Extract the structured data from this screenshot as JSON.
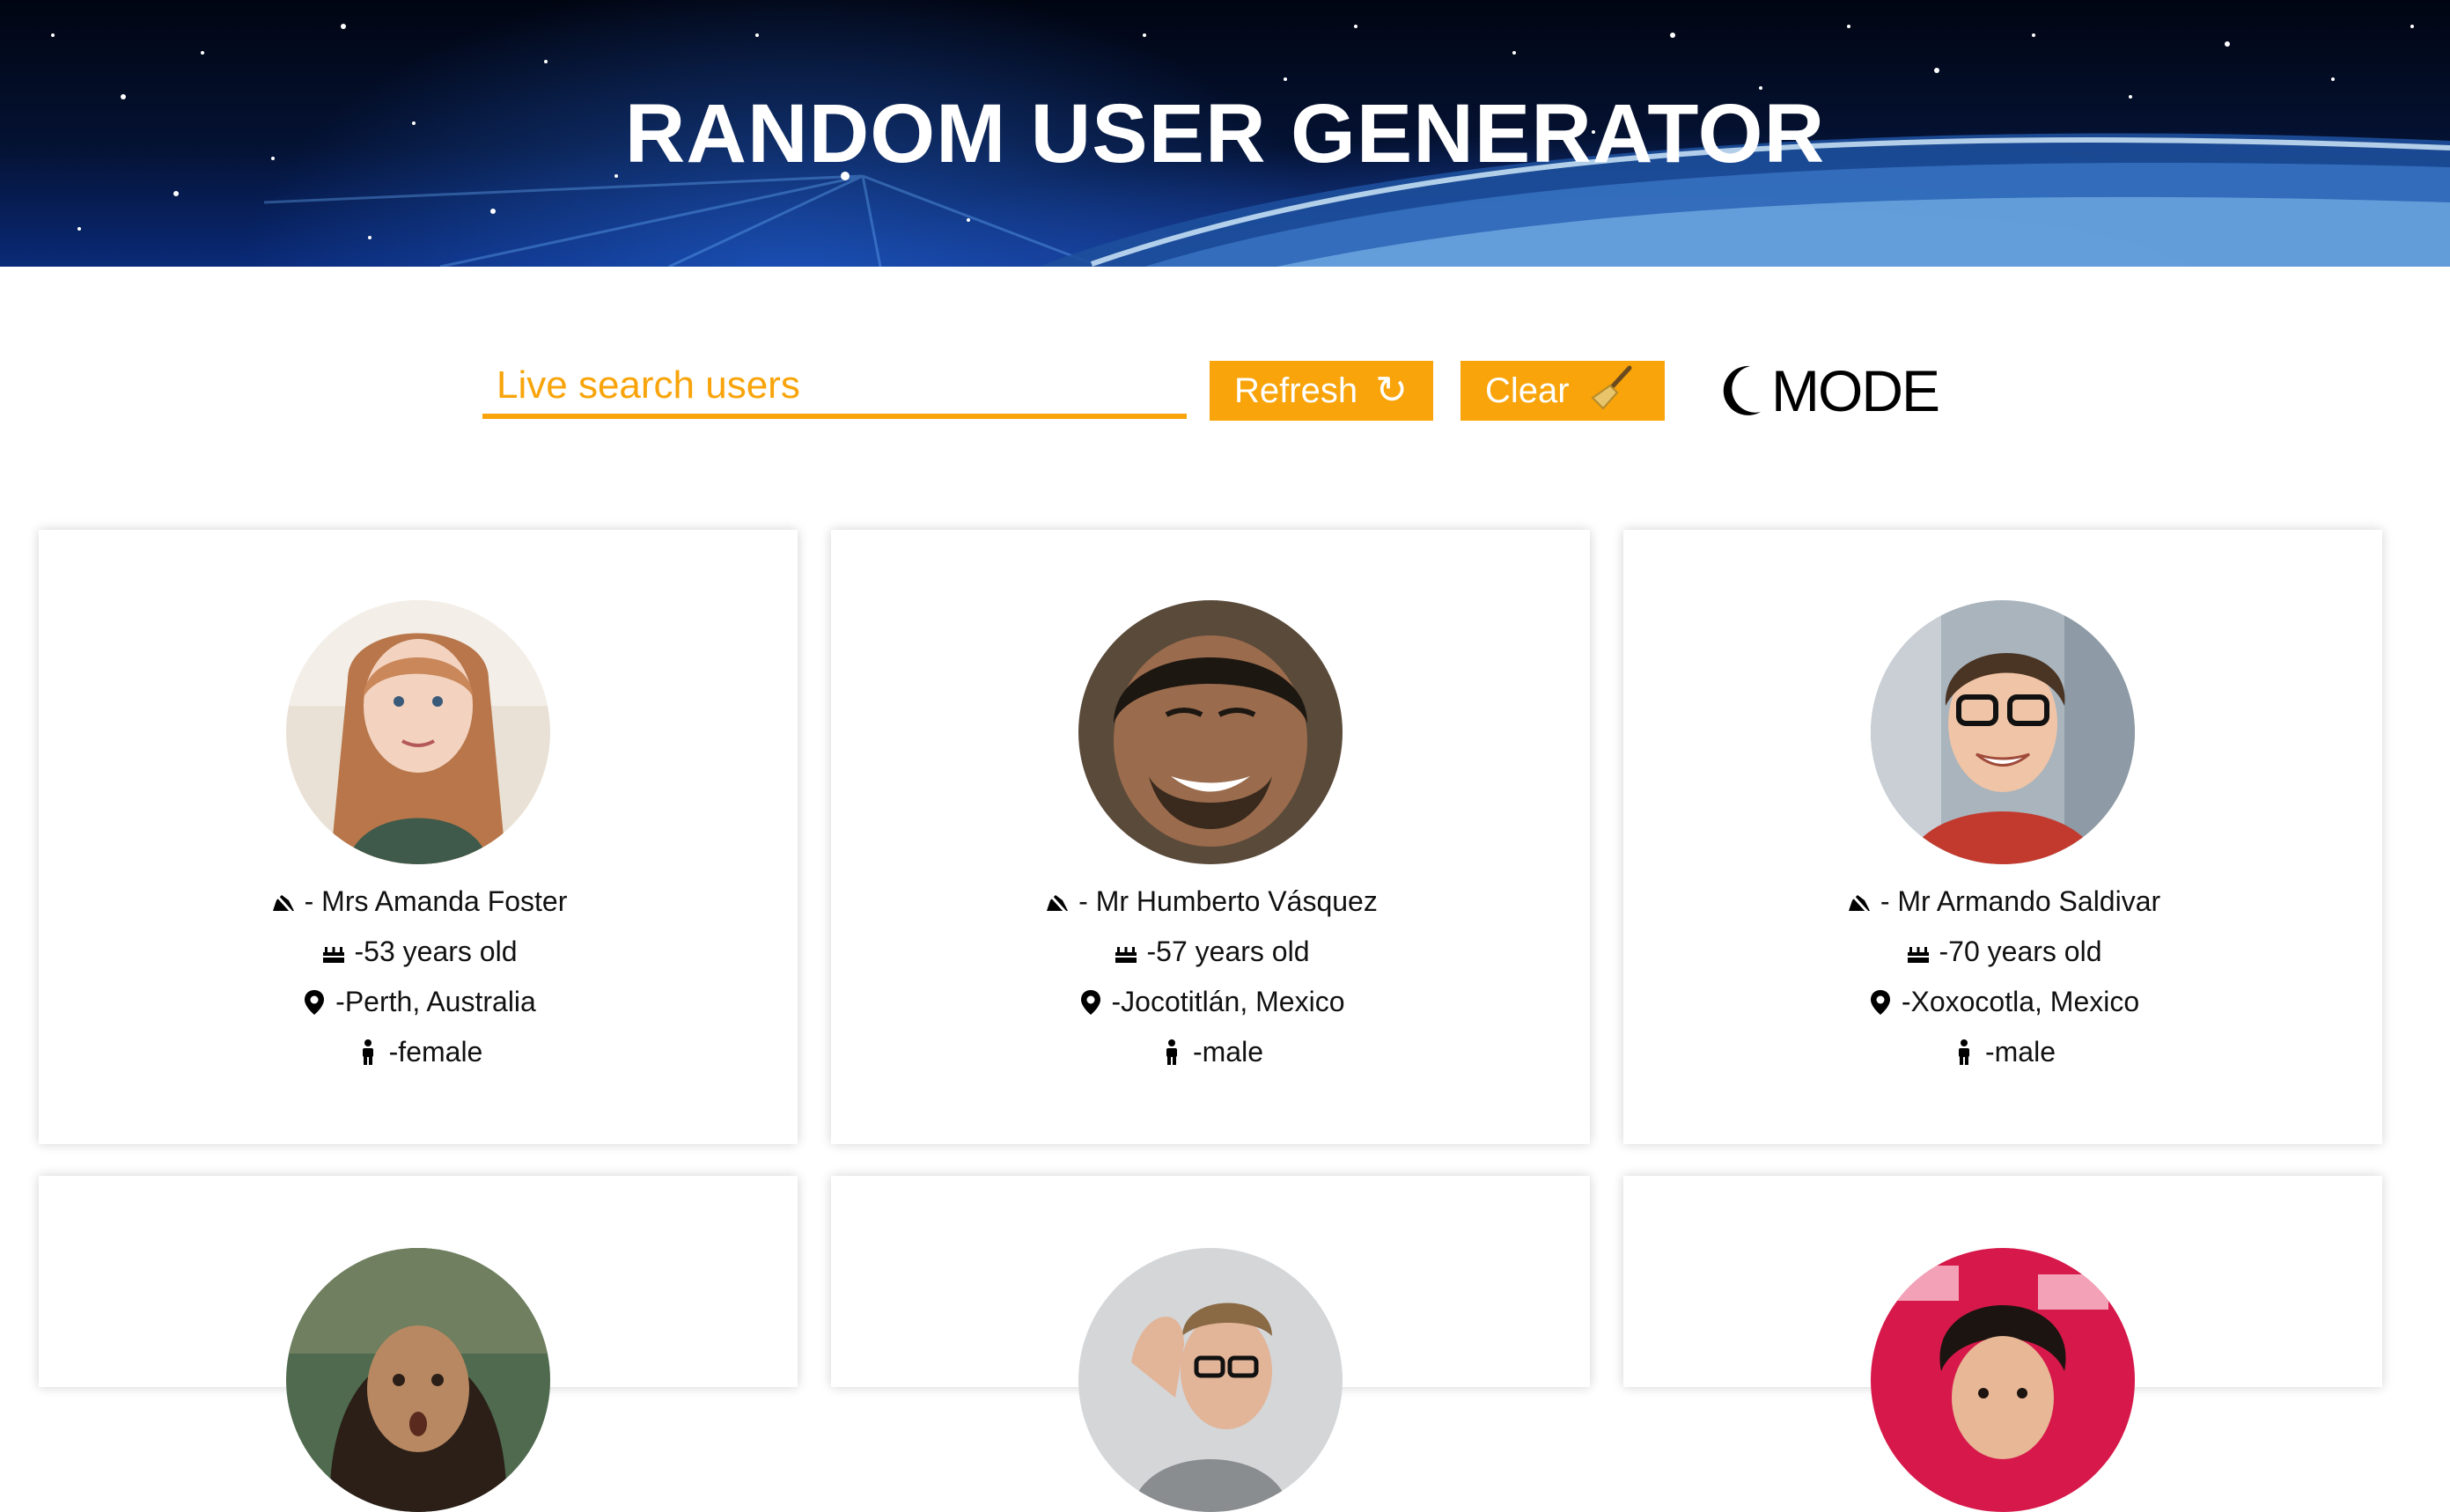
{
  "header": {
    "title": "RANDOM USER GENERATOR"
  },
  "controls": {
    "search_placeholder": "Live search users",
    "refresh_label": "Refresh",
    "refresh_icon": "refresh-icon",
    "clear_label": "Clear",
    "clear_icon": "broom-icon",
    "mode_label": "MODE",
    "mode_icon": "moon-icon"
  },
  "colors": {
    "accent": "#f8a40a",
    "header_dark": "#041233"
  },
  "users": [
    {
      "name": "- Mrs Amanda Foster",
      "age": "-53 years old",
      "location": "-Perth, Australia",
      "gender": "-female"
    },
    {
      "name": "- Mr Humberto Vásquez",
      "age": "-57 years old",
      "location": "-Jocotitlán, Mexico",
      "gender": "-male"
    },
    {
      "name": "- Mr Armando Saldivar",
      "age": "-70 years old",
      "location": "-Xoxocotla, Mexico",
      "gender": "-male"
    },
    {
      "name": "",
      "age": "",
      "location": "",
      "gender": ""
    },
    {
      "name": "",
      "age": "",
      "location": "",
      "gender": ""
    },
    {
      "name": "",
      "age": "",
      "location": "",
      "gender": ""
    }
  ]
}
